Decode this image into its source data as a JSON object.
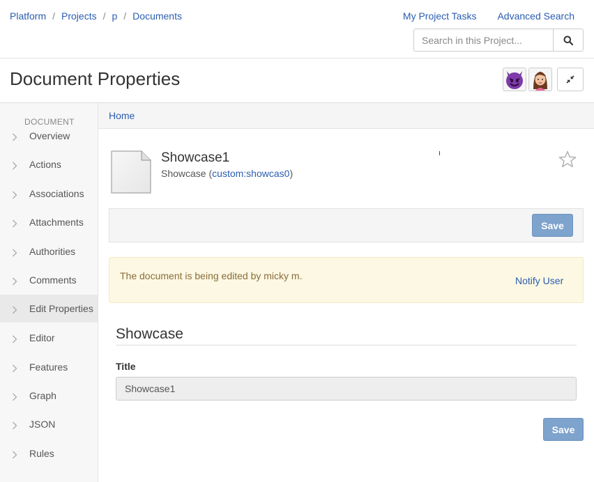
{
  "breadcrumb": [
    "Platform",
    "Projects",
    "p",
    "Documents"
  ],
  "breadcrumb_separator": "/",
  "top_links": {
    "tasks": "My Project Tasks",
    "advanced_search": "Advanced Search"
  },
  "search": {
    "placeholder": "Search in this Project...",
    "value": "",
    "icon": "search-icon"
  },
  "header": {
    "title": "Document Properties",
    "avatars": [
      {
        "icon": "devil-emoji-avatar"
      },
      {
        "icon": "woman-emoji-avatar"
      }
    ],
    "collapse_icon": "collapse-arrows-icon"
  },
  "sidebar": {
    "heading": "DOCUMENT",
    "items": [
      {
        "label": "Overview",
        "active": false
      },
      {
        "label": "Actions",
        "active": false
      },
      {
        "label": "Associations",
        "active": false
      },
      {
        "label": "Attachments",
        "active": false
      },
      {
        "label": "Authorities",
        "active": false
      },
      {
        "label": "Comments",
        "active": false
      },
      {
        "label": "Edit Properties",
        "active": true
      },
      {
        "label": "Editor",
        "active": false
      },
      {
        "label": "Features",
        "active": false
      },
      {
        "label": "Graph",
        "active": false
      },
      {
        "label": "JSON",
        "active": false
      },
      {
        "label": "Rules",
        "active": false
      }
    ]
  },
  "subnav": {
    "home": "Home"
  },
  "document": {
    "title": "Showcase1",
    "type_label": "Showcase",
    "type_open": "(",
    "type_id": "custom:showcas0",
    "type_close": ")"
  },
  "actions": {
    "save_top": "Save",
    "save_bottom": "Save"
  },
  "alert": {
    "message": "The document is being edited by micky m.",
    "action": "Notify User"
  },
  "form": {
    "section_title": "Showcase",
    "fields": [
      {
        "label": "Title",
        "value": "Showcase1"
      }
    ]
  },
  "colors": {
    "link": "#2a5db0",
    "save_button": "#7ea3cc",
    "alert_bg": "#fcf8e3",
    "alert_text": "#8a6d3b"
  }
}
